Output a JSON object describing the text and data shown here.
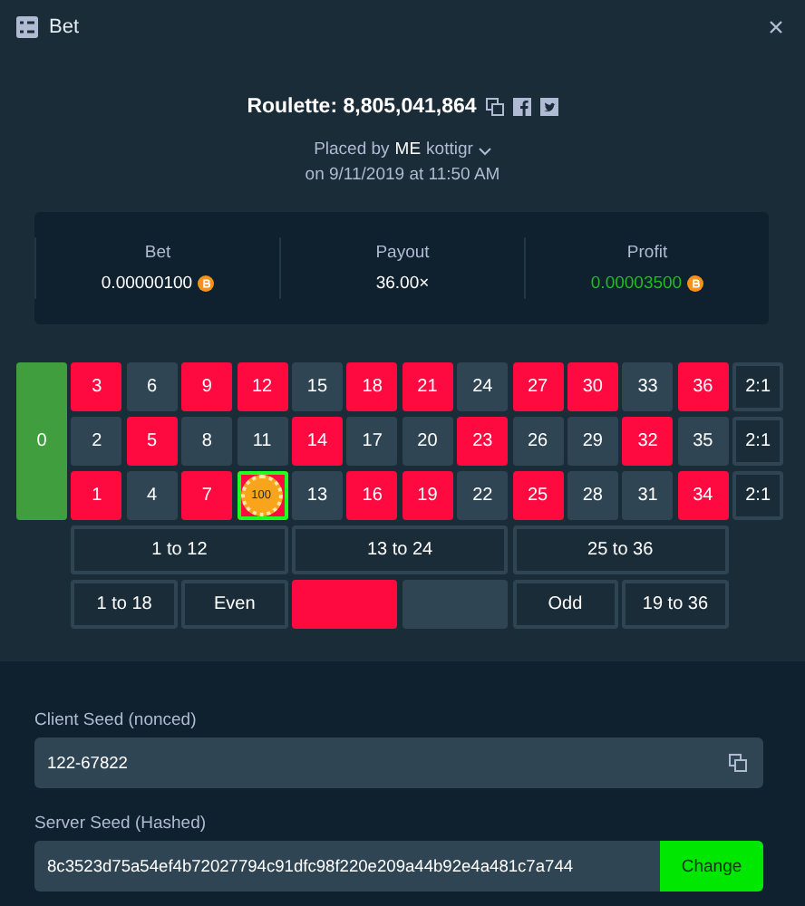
{
  "window": {
    "title": "Bet"
  },
  "bet": {
    "title": "Roulette: 8,805,041,864",
    "placed_by": "Placed by",
    "badge": "ME",
    "user": "kottigr",
    "date": "on 9/11/2019 at 11:50 AM"
  },
  "stats": [
    {
      "label": "Bet",
      "value": "0.00000100",
      "coin": true,
      "kind": "plain"
    },
    {
      "label": "Payout",
      "value": "36.00×",
      "coin": false,
      "kind": "plain"
    },
    {
      "label": "Profit",
      "value": "0.00003500",
      "coin": true,
      "kind": "win"
    }
  ],
  "board": {
    "zero": {
      "label": "0",
      "color": "#419e3f"
    },
    "rows": [
      [
        {
          "label": "3",
          "color": "#fe0a40",
          "selected": false
        },
        {
          "label": "6",
          "color": "#2f4553",
          "selected": false
        },
        {
          "label": "9",
          "color": "#fe0a40",
          "selected": false
        },
        {
          "label": "12",
          "color": "#fe0a40",
          "selected": false
        },
        {
          "label": "15",
          "color": "#2f4553",
          "selected": false
        },
        {
          "label": "18",
          "color": "#fe0a40",
          "selected": false
        },
        {
          "label": "21",
          "color": "#fe0a40",
          "selected": false
        },
        {
          "label": "24",
          "color": "#2f4553",
          "selected": false
        },
        {
          "label": "27",
          "color": "#fe0a40",
          "selected": false
        },
        {
          "label": "30",
          "color": "#fe0a40",
          "selected": false
        },
        {
          "label": "33",
          "color": "#2f4553",
          "selected": false
        },
        {
          "label": "36",
          "color": "#fe0a40",
          "selected": false
        },
        {
          "label": "2:1",
          "selected": false
        }
      ],
      [
        {
          "label": "2",
          "color": "#2f4553",
          "selected": false
        },
        {
          "label": "5",
          "color": "#fe0a40",
          "selected": false
        },
        {
          "label": "8",
          "color": "#2f4553",
          "selected": false
        },
        {
          "label": "11",
          "color": "#2f4553",
          "selected": false
        },
        {
          "label": "14",
          "color": "#fe0a40",
          "selected": false
        },
        {
          "label": "17",
          "color": "#2f4553",
          "selected": false
        },
        {
          "label": "20",
          "color": "#2f4553",
          "selected": false
        },
        {
          "label": "23",
          "color": "#fe0a40",
          "selected": false
        },
        {
          "label": "26",
          "color": "#2f4553",
          "selected": false
        },
        {
          "label": "29",
          "color": "#2f4553",
          "selected": false
        },
        {
          "label": "32",
          "color": "#fe0a40",
          "selected": false
        },
        {
          "label": "35",
          "color": "#2f4553",
          "selected": false
        },
        {
          "label": "2:1",
          "selected": false
        }
      ],
      [
        {
          "label": "1",
          "color": "#fe0a40",
          "selected": false
        },
        {
          "label": "4",
          "color": "#2f4553",
          "selected": false
        },
        {
          "label": "7",
          "color": "#fe0a40",
          "selected": false
        },
        {
          "color": "#fe0a40",
          "selected": true,
          "chip": "100"
        },
        {
          "label": "13",
          "color": "#2f4553",
          "selected": false
        },
        {
          "label": "16",
          "color": "#fe0a40",
          "selected": false
        },
        {
          "label": "19",
          "color": "#fe0a40",
          "selected": false
        },
        {
          "label": "22",
          "color": "#2f4553",
          "selected": false
        },
        {
          "label": "25",
          "color": "#fe0a40",
          "selected": false
        },
        {
          "label": "28",
          "color": "#2f4553",
          "selected": false
        },
        {
          "label": "31",
          "color": "#2f4553",
          "selected": false
        },
        {
          "label": "34",
          "color": "#fe0a40",
          "selected": false
        },
        {
          "label": "2:1",
          "selected": false
        }
      ]
    ],
    "dozens": [
      "1 to 12",
      "13 to 24",
      "25 to 36"
    ],
    "outside": [
      {
        "kind": "text",
        "label": "1 to 18"
      },
      {
        "kind": "text",
        "label": "Even"
      },
      {
        "kind": "swatch",
        "color": "#fe0a40"
      },
      {
        "kind": "swatch",
        "color": "#2f4553"
      },
      {
        "kind": "text",
        "label": "Odd"
      },
      {
        "kind": "text",
        "label": "19 to 36"
      }
    ]
  },
  "seeds": {
    "client_label": "Client Seed (nonced)",
    "client_value": "122-67822",
    "server_label": "Server Seed (Hashed)",
    "server_value": "8c3523d75a54ef4b72027794c91dfc98f220e209a44b92e4a481c7a744",
    "change": "Change"
  }
}
